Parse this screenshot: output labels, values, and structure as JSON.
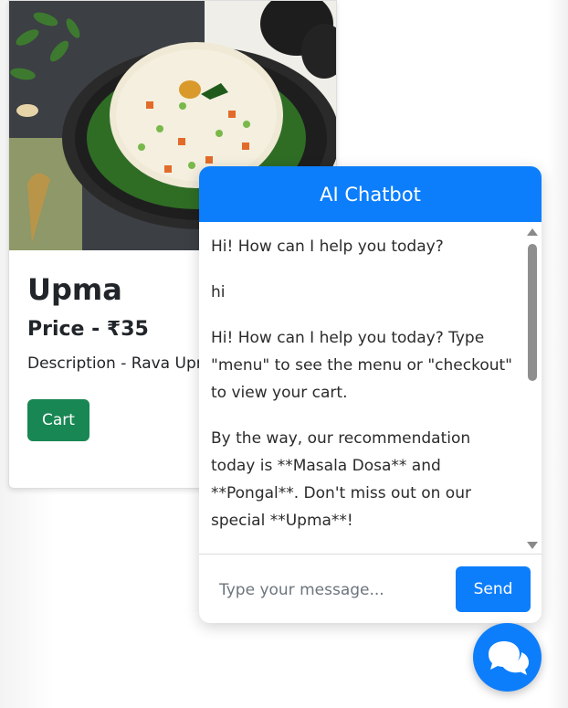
{
  "product": {
    "name": "Upma",
    "price": "Price - ₹35",
    "description": "Description - Rava Upma",
    "cart_label": "Cart"
  },
  "chat": {
    "title": "AI Chatbot",
    "messages": [
      {
        "text": "Hi! How can I help you today?"
      },
      {
        "text": "hi"
      },
      {
        "text": "Hi! How can I help you today? Type \"menu\" to see the menu or \"checkout\" to view your cart."
      },
      {
        "text": "By the way, our recommendation today is **Masala Dosa** and **Pongal**. Don't miss out on our special **Upma**!"
      }
    ],
    "input_placeholder": "Type your message...",
    "send_label": "Send"
  },
  "colors": {
    "primary": "#0d7efb",
    "cart_green": "#198754"
  },
  "icons": {
    "chat_toggle": "chat-bubbles-icon"
  }
}
